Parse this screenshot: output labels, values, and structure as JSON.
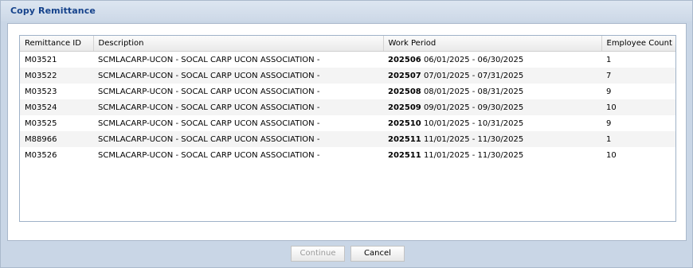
{
  "dialog": {
    "title": "Copy Remittance"
  },
  "table": {
    "columns": [
      "Remittance ID",
      "Description",
      "Work Period",
      "Employee Count"
    ],
    "rows": [
      {
        "id": "M03521",
        "description": "SCMLACARP-UCON - SOCAL CARP UCON ASSOCIATION -",
        "period_code": "202506",
        "period_range": "06/01/2025 - 06/30/2025",
        "count": "1"
      },
      {
        "id": "M03522",
        "description": "SCMLACARP-UCON - SOCAL CARP UCON ASSOCIATION -",
        "period_code": "202507",
        "period_range": "07/01/2025 - 07/31/2025",
        "count": "7"
      },
      {
        "id": "M03523",
        "description": "SCMLACARP-UCON - SOCAL CARP UCON ASSOCIATION -",
        "period_code": "202508",
        "period_range": "08/01/2025 - 08/31/2025",
        "count": "9"
      },
      {
        "id": "M03524",
        "description": "SCMLACARP-UCON - SOCAL CARP UCON ASSOCIATION -",
        "period_code": "202509",
        "period_range": "09/01/2025 - 09/30/2025",
        "count": "10"
      },
      {
        "id": "M03525",
        "description": "SCMLACARP-UCON - SOCAL CARP UCON ASSOCIATION -",
        "period_code": "202510",
        "period_range": "10/01/2025 - 10/31/2025",
        "count": "9"
      },
      {
        "id": "M88966",
        "description": "SCMLACARP-UCON - SOCAL CARP UCON ASSOCIATION -",
        "period_code": "202511",
        "period_range": "11/01/2025 - 11/30/2025",
        "count": "1"
      },
      {
        "id": "M03526",
        "description": "SCMLACARP-UCON - SOCAL CARP UCON ASSOCIATION -",
        "period_code": "202511",
        "period_range": "11/01/2025 - 11/30/2025",
        "count": "10"
      }
    ]
  },
  "footer": {
    "continue_label": "Continue",
    "cancel_label": "Cancel"
  }
}
